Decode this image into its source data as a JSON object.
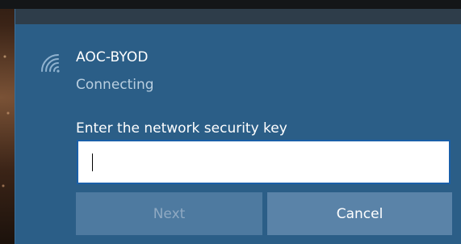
{
  "network": {
    "name": "AOC-BYOD",
    "status": "Connecting",
    "icon": "wifi-secured-icon"
  },
  "security_key": {
    "label": "Enter the network security key",
    "value": ""
  },
  "buttons": {
    "next_label": "Next",
    "cancel_label": "Cancel",
    "next_enabled": false
  },
  "colors": {
    "panel": "#2b5e87",
    "input_border": "#1a5fa8",
    "button_bg": "#5a83a8",
    "disabled_text": "#8fa9c2"
  }
}
